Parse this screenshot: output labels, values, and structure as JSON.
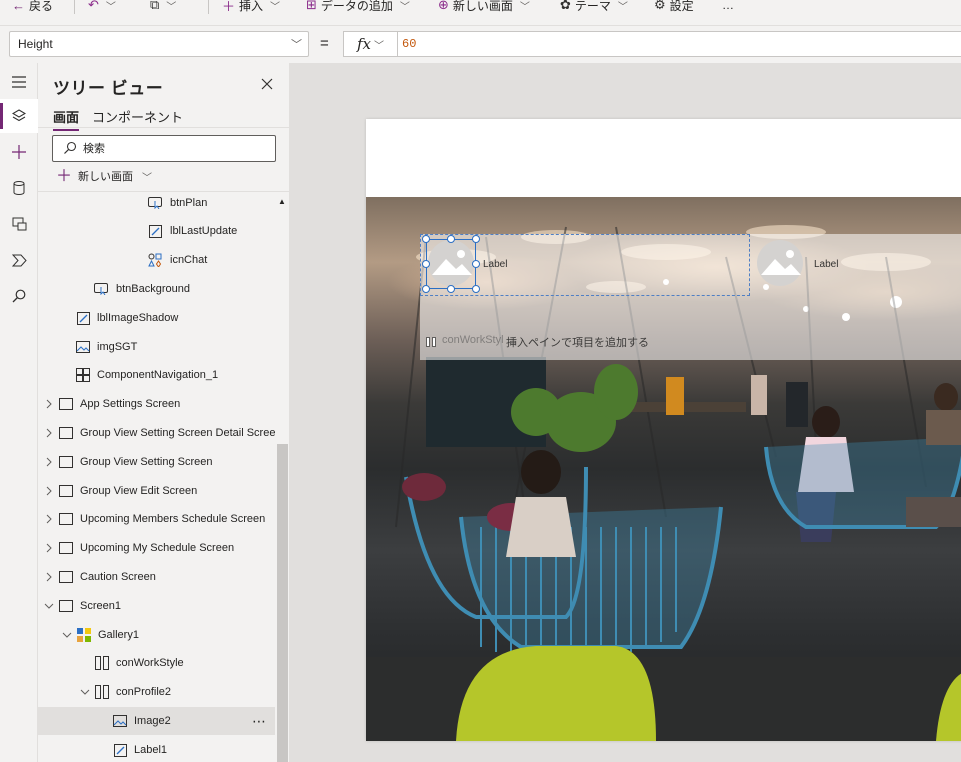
{
  "toolbar": {
    "back": "戻る",
    "insert": "挿入",
    "add_data": "データの追加",
    "new_screen": "新しい画面",
    "theme": "テーマ",
    "settings": "設定",
    "more": "…"
  },
  "formula_bar": {
    "property": "Height",
    "equals": "=",
    "fx": "fx",
    "value": "60"
  },
  "tree_view": {
    "title": "ツリー ビュー",
    "tabs": [
      "画面",
      "コンポーネント"
    ],
    "active_tab": "画面",
    "search_placeholder": "検索",
    "new_screen": "新しい画面",
    "items": [
      {
        "label": "btnPlan",
        "type": "button"
      },
      {
        "label": "lblLastUpdate",
        "type": "label"
      },
      {
        "label": "icnChat",
        "type": "icon"
      },
      {
        "label": "btnBackground",
        "type": "button"
      },
      {
        "label": "lblImageShadow",
        "type": "label"
      },
      {
        "label": "imgSGT",
        "type": "image"
      },
      {
        "label": "ComponentNavigation_1",
        "type": "component"
      },
      {
        "label": "App Settings Screen",
        "type": "screen"
      },
      {
        "label": "Group View Setting Screen Detail Screen",
        "type": "screen"
      },
      {
        "label": "Group View Setting Screen",
        "type": "screen"
      },
      {
        "label": "Group View Edit Screen",
        "type": "screen"
      },
      {
        "label": "Upcoming Members Schedule Screen",
        "type": "screen"
      },
      {
        "label": "Upcoming My Schedule Screen",
        "type": "screen"
      },
      {
        "label": "Caution Screen",
        "type": "screen"
      },
      {
        "label": "Screen1",
        "type": "screen",
        "expanded": true
      },
      {
        "label": "Gallery1",
        "type": "gallery",
        "expanded": true
      },
      {
        "label": "conWorkStyle",
        "type": "container"
      },
      {
        "label": "conProfile2",
        "type": "container",
        "expanded": true
      },
      {
        "label": "Image2",
        "type": "image",
        "selected": true,
        "more": "⋯"
      },
      {
        "label": "Label1",
        "type": "label"
      }
    ]
  },
  "canvas": {
    "gallery_labels": [
      "Label",
      "Label"
    ],
    "hint_text": "挿入ペインで項目を追加する",
    "ghost_text": "conWorkStyl"
  },
  "colors": {
    "accent": "#742774",
    "selection": "#2b6fc4",
    "formula_value": "#c4590e"
  }
}
